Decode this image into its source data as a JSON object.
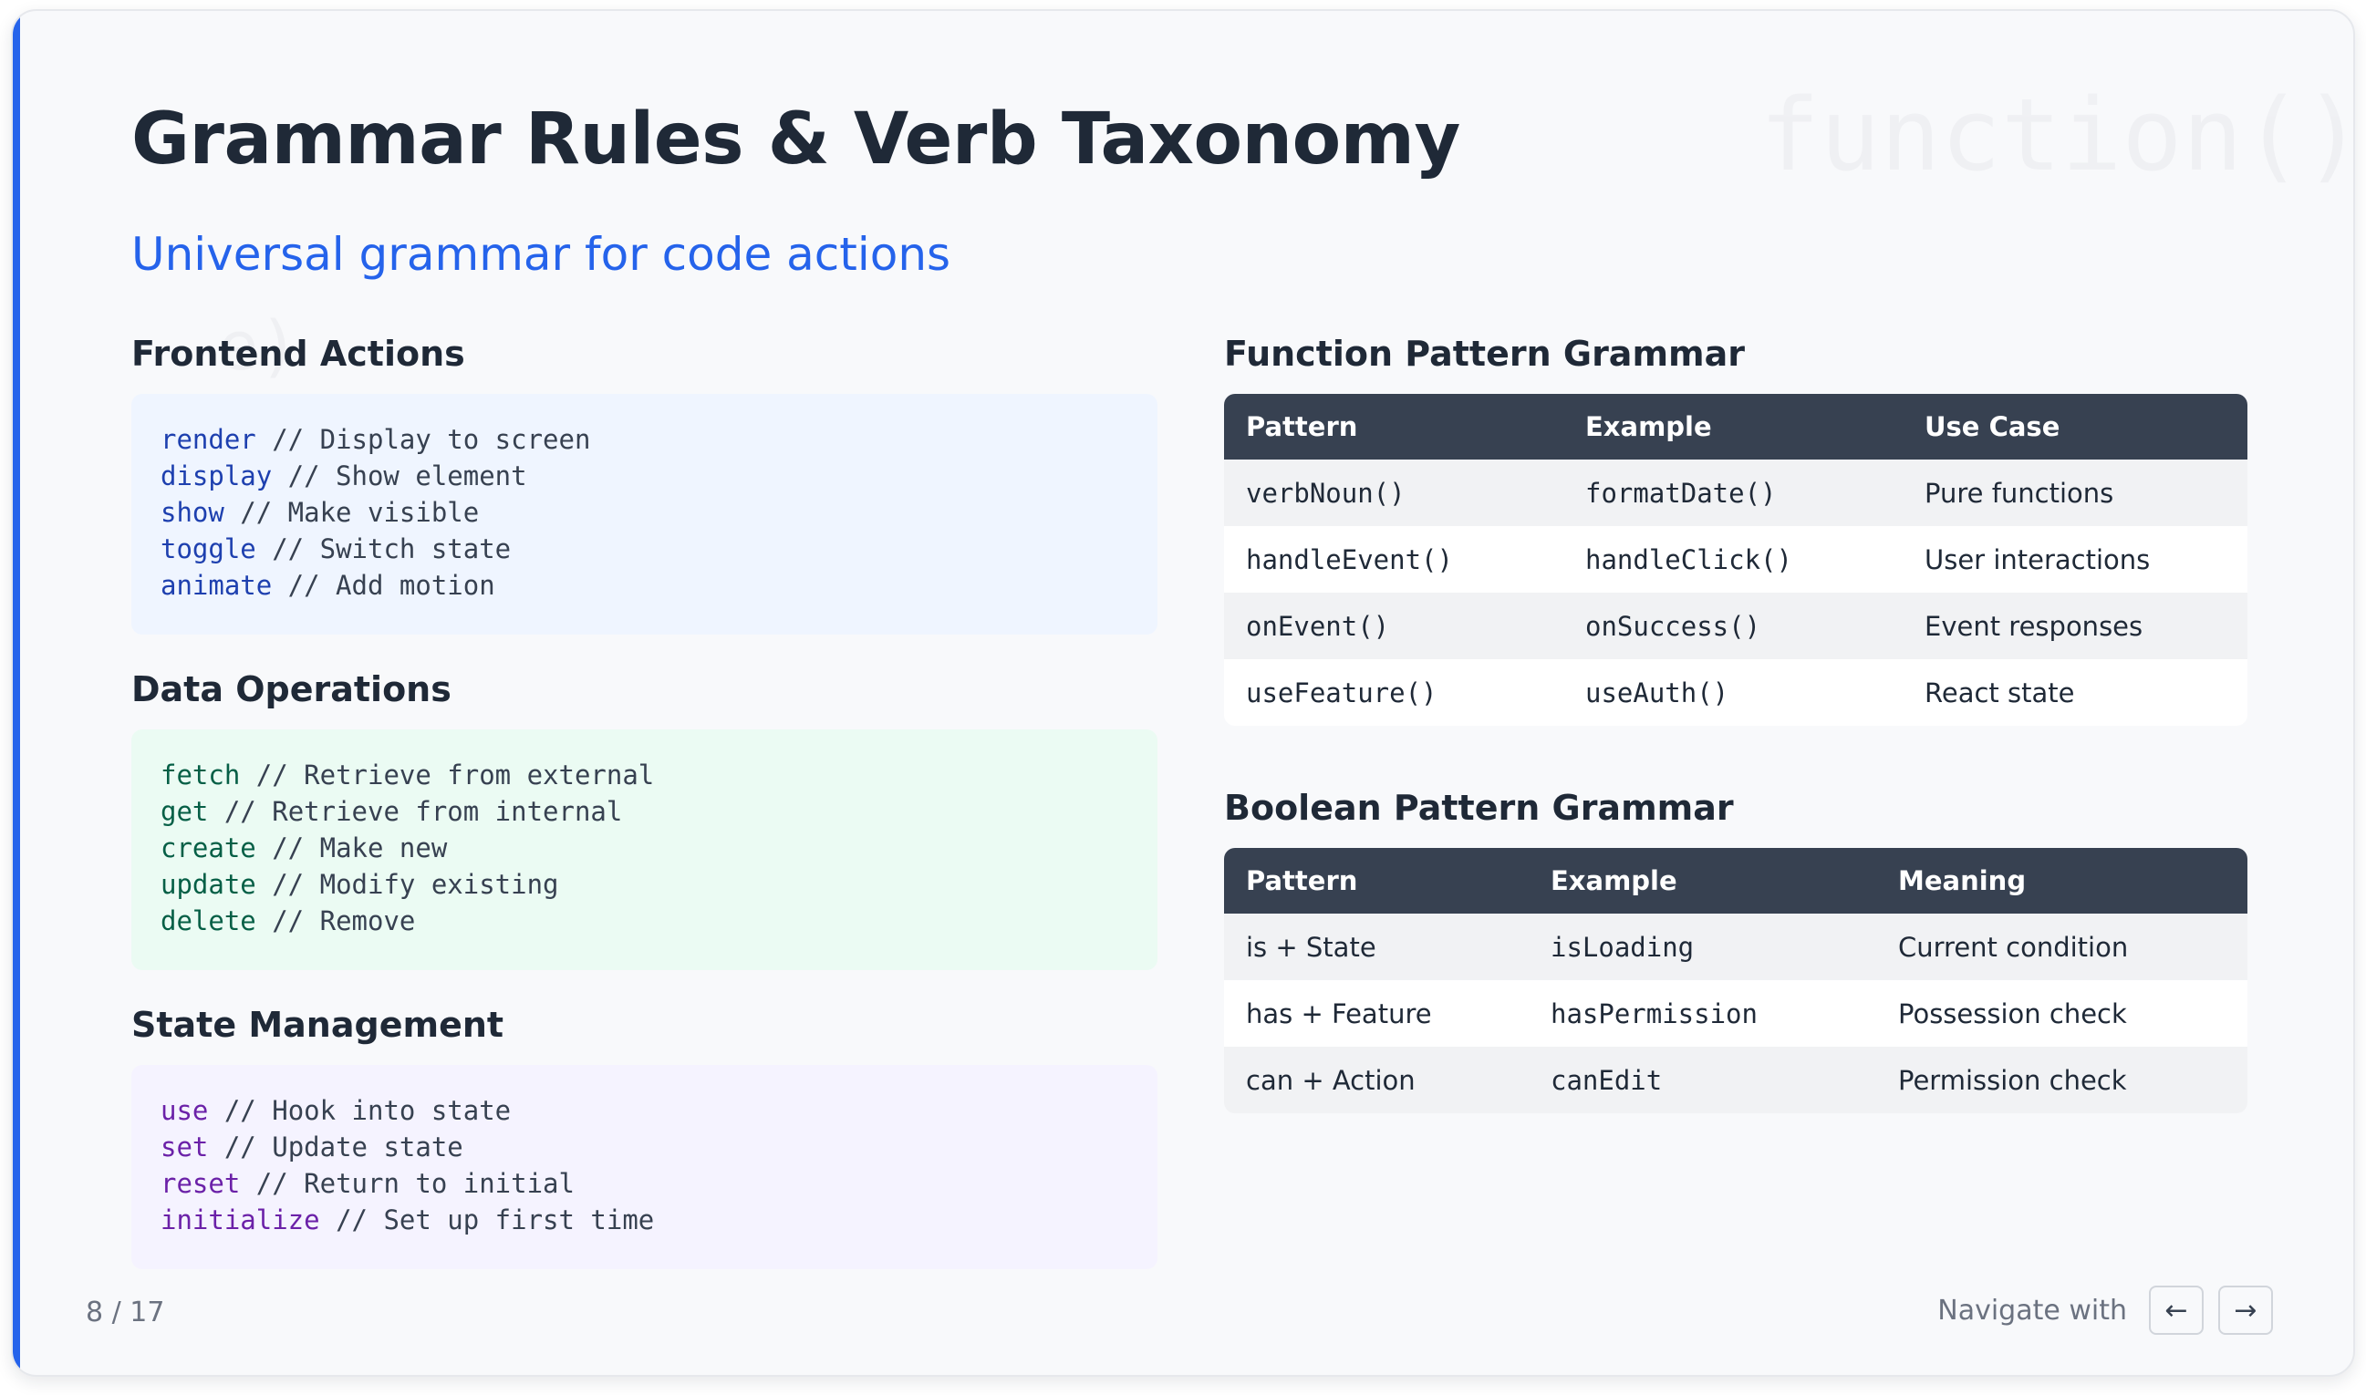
{
  "slide": {
    "title": "Grammar Rules & Verb Taxonomy",
    "subtitle": "Universal grammar for code actions",
    "watermark_1": "function()",
    "watermark_2": "e)"
  },
  "left": {
    "sections": [
      {
        "heading": "Frontend Actions",
        "lines": [
          {
            "kw": "render",
            "comment": " // Display to screen"
          },
          {
            "kw": "display",
            "comment": " // Show element"
          },
          {
            "kw": "show",
            "comment": " // Make visible"
          },
          {
            "kw": "toggle",
            "comment": " // Switch state"
          },
          {
            "kw": "animate",
            "comment": " // Add motion"
          }
        ]
      },
      {
        "heading": "Data Operations",
        "lines": [
          {
            "kw": "fetch",
            "comment": " // Retrieve from external"
          },
          {
            "kw": "get",
            "comment": " // Retrieve from internal"
          },
          {
            "kw": "create",
            "comment": " // Make new"
          },
          {
            "kw": "update",
            "comment": " // Modify existing"
          },
          {
            "kw": "delete",
            "comment": " // Remove"
          }
        ]
      },
      {
        "heading": "State Management",
        "lines": [
          {
            "kw": "use",
            "comment": " // Hook into state"
          },
          {
            "kw": "set",
            "comment": " // Update state"
          },
          {
            "kw": "reset",
            "comment": " // Return to initial"
          },
          {
            "kw": "initialize",
            "comment": " // Set up first time"
          }
        ]
      }
    ]
  },
  "function_table": {
    "heading": "Function Pattern Grammar",
    "headers": [
      "Pattern",
      "Example",
      "Use Case"
    ],
    "rows": [
      [
        "verbNoun()",
        "formatDate()",
        "Pure functions"
      ],
      [
        "handleEvent()",
        "handleClick()",
        "User interactions"
      ],
      [
        "onEvent()",
        "onSuccess()",
        "Event responses"
      ],
      [
        "useFeature()",
        "useAuth()",
        "React state"
      ]
    ]
  },
  "boolean_table": {
    "heading": "Boolean Pattern Grammar",
    "headers": [
      "Pattern",
      "Example",
      "Meaning"
    ],
    "rows": [
      [
        "is + State",
        "isLoading",
        "Current condition"
      ],
      [
        "has + Feature",
        "hasPermission",
        "Possession check"
      ],
      [
        "can + Action",
        "canEdit",
        "Permission check"
      ]
    ]
  },
  "footer": {
    "page_counter": "8 / 17",
    "navigate_label": "Navigate with",
    "prev_arrow": "←",
    "next_arrow": "→"
  },
  "colors": {
    "accent": "#2563eb",
    "table_header": "#374151",
    "frontend_box": "#eff5ff",
    "data_box": "#ebfbf3",
    "state_box": "#f5f3ff"
  }
}
